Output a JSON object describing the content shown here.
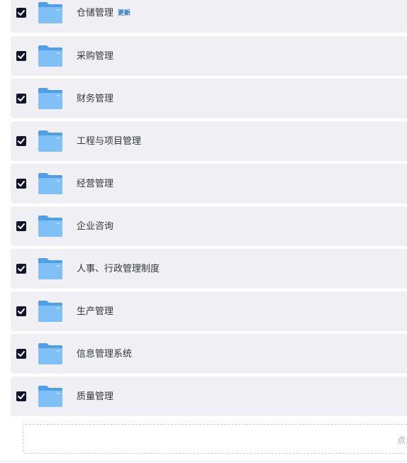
{
  "items": [
    {
      "label": "仓储管理",
      "badge": "更新",
      "checked": true
    },
    {
      "label": "采购管理",
      "checked": true
    },
    {
      "label": "财务管理",
      "checked": true
    },
    {
      "label": "工程与项目管理",
      "checked": true
    },
    {
      "label": "经营管理",
      "checked": true
    },
    {
      "label": "企业咨询",
      "checked": true
    },
    {
      "label": "人事、行政管理制度",
      "checked": true
    },
    {
      "label": "生产管理",
      "checked": true
    },
    {
      "label": "信息管理系统",
      "checked": true
    },
    {
      "label": "质量管理",
      "checked": true
    }
  ],
  "upload": {
    "hint": "点击"
  },
  "colors": {
    "row_bg": "#f0eff3",
    "checkbox": "#10142a",
    "folder": "#5aa9f0",
    "badge": "#1f6fd6",
    "text": "#333740"
  },
  "icons": {
    "checkbox": "check-icon",
    "folder": "folder-icon"
  }
}
